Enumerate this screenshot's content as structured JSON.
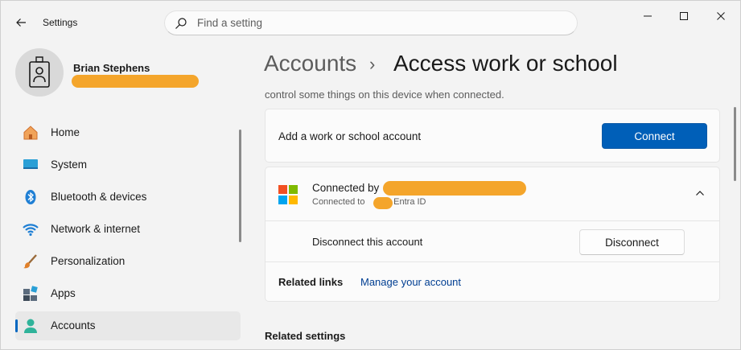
{
  "window": {
    "app_title": "Settings",
    "back_icon": "arrow-left-icon",
    "controls": [
      "minimize-icon",
      "maximize-icon",
      "close-icon"
    ]
  },
  "search": {
    "placeholder": "Find a setting",
    "icon": "search-icon"
  },
  "profile": {
    "name": "Brian Stephens",
    "avatar_icon": "badge-person-icon",
    "email_redacted": true
  },
  "sidebar": {
    "items": [
      {
        "label": "Home",
        "icon": "home-icon",
        "active": false
      },
      {
        "label": "System",
        "icon": "monitor-icon",
        "active": false
      },
      {
        "label": "Bluetooth & devices",
        "icon": "bluetooth-icon",
        "active": false
      },
      {
        "label": "Network & internet",
        "icon": "wifi-icon",
        "active": false
      },
      {
        "label": "Personalization",
        "icon": "brush-icon",
        "active": false
      },
      {
        "label": "Apps",
        "icon": "apps-icon",
        "active": false
      },
      {
        "label": "Accounts",
        "icon": "person-icon",
        "active": true
      }
    ]
  },
  "breadcrumb": {
    "parent": "Accounts",
    "separator": "›",
    "current": "Access work or school"
  },
  "description": "control some things on this device when connected.",
  "add_account": {
    "label": "Add a work or school account",
    "button": "Connect"
  },
  "connected_account": {
    "title_prefix": "Connected by",
    "subtitle_prefix": "Connected to",
    "subtitle_suffix": "'s Entra ID",
    "logo_icon": "microsoft-logo-icon",
    "expand_icon": "chevron-up-icon",
    "disconnect_label": "Disconnect this account",
    "disconnect_button": "Disconnect",
    "related_links_label": "Related links",
    "manage_link": "Manage your account"
  },
  "related_settings": {
    "heading": "Related settings"
  },
  "colors": {
    "accent": "#005fb8",
    "link": "#003e92",
    "redaction": "#f4a52b"
  }
}
